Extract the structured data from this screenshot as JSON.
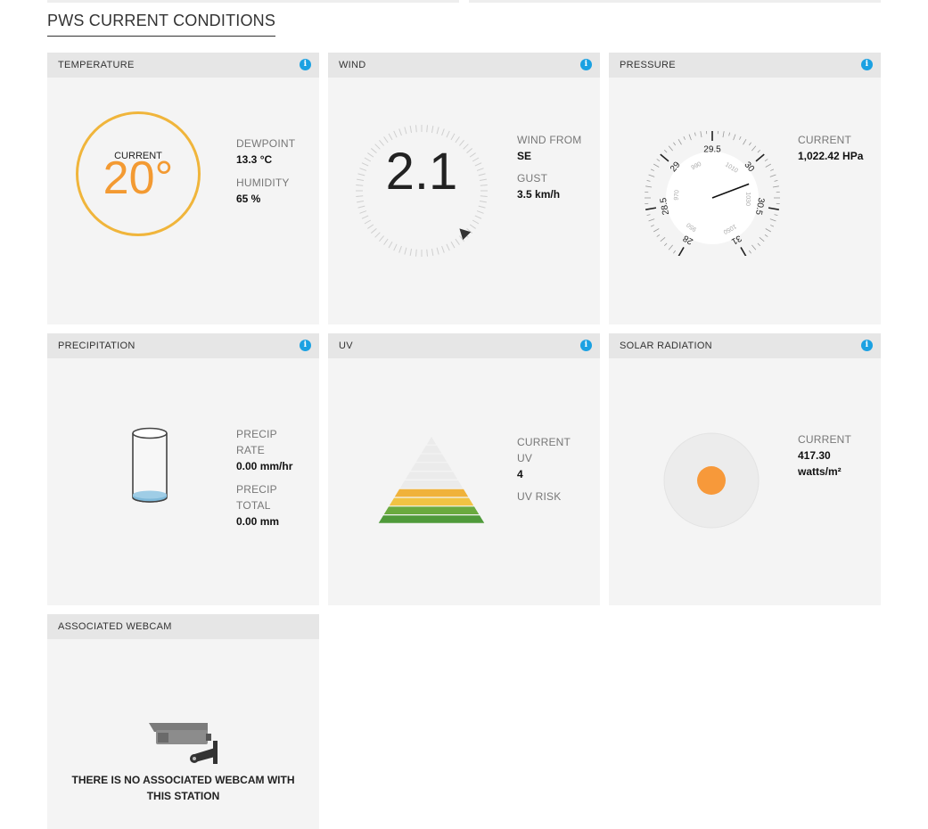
{
  "page": {
    "title": "PWS CURRENT CONDITIONS"
  },
  "colors": {
    "accent_info": "#1ba1e2",
    "temperature": "#f39a32",
    "temperature_ring": "#f0b53b",
    "solar_sun": "#f7993a",
    "precip_water": "#7fb9d9"
  },
  "temperature": {
    "header": "TEMPERATURE",
    "current_label": "CURRENT",
    "current_value": "20°",
    "dewpoint_label": "DEWPOINT",
    "dewpoint_value": "13.3 °C",
    "humidity_label": "HUMIDITY",
    "humidity_value": "65 %"
  },
  "wind": {
    "header": "WIND",
    "speed": "2.1",
    "from_label": "WIND FROM",
    "from_value": "SE",
    "gust_label": "GUST",
    "gust_value": "3.5 km/h"
  },
  "pressure": {
    "header": "PRESSURE",
    "current_label": "CURRENT",
    "current_value": "1,022.42 HPa",
    "inhg_ticks": [
      "28",
      "28.5",
      "29",
      "29.5",
      "30",
      "30.5",
      "31"
    ],
    "hpa_ticks": [
      "950",
      "970",
      "990",
      "1010",
      "1030",
      "1050"
    ]
  },
  "precipitation": {
    "header": "PRECIPITATION",
    "rate_label_1": "PRECIP",
    "rate_label_2": "RATE",
    "rate_value": "0.00 mm/hr",
    "total_label_1": "PRECIP",
    "total_label_2": "TOTAL",
    "total_value": "0.00 mm"
  },
  "uv": {
    "header": "UV",
    "current_label_1": "CURRENT",
    "current_label_2": "UV",
    "current_value": "4",
    "risk_label": "UV RISK"
  },
  "solar": {
    "header": "SOLAR RADIATION",
    "current_label": "CURRENT",
    "current_value": "417.30",
    "unit": "watts/m²"
  },
  "webcam": {
    "header": "ASSOCIATED WEBCAM",
    "message_1": "THERE IS NO ASSOCIATED WEBCAM WITH",
    "message_2": "THIS STATION",
    "icon": "security-camera-icon"
  },
  "icons": {
    "info": "info-icon"
  }
}
